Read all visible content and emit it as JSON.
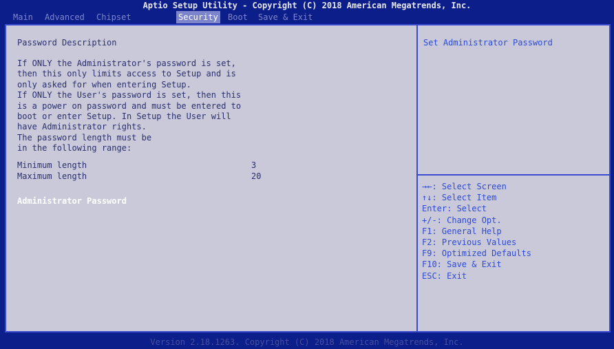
{
  "header": {
    "title": "Aptio Setup Utility - Copyright (C) 2018 American Megatrends, Inc."
  },
  "menu": {
    "tabs": [
      {
        "label": "Main",
        "active": false
      },
      {
        "label": "Advanced",
        "active": false
      },
      {
        "label": "Chipset",
        "active": false
      },
      {
        "label": "Security",
        "active": true
      },
      {
        "label": "Boot",
        "active": false
      },
      {
        "label": "Save & Exit",
        "active": false
      }
    ]
  },
  "security": {
    "description_title": "Password Description",
    "description_lines": [
      "If ONLY the Administrator's password is set,",
      "then this only limits access to Setup and is",
      "only asked for when entering Setup.",
      "If ONLY the User's password is set, then this",
      "is a power on password and must be entered to",
      "boot or enter Setup. In Setup the User will",
      "have Administrator rights.",
      "The password length must be",
      "in the following range:"
    ],
    "min_length_label": "Minimum length",
    "min_length_value": "3",
    "max_length_label": "Maximum length",
    "max_length_value": "20",
    "admin_password_label": "Administrator Password"
  },
  "help": {
    "text": "Set Administrator Password",
    "keys": [
      "→←: Select Screen",
      "↑↓: Select Item",
      "Enter: Select",
      "+/-: Change Opt.",
      "F1: General Help",
      "F2: Previous Values",
      "F9: Optimized Defaults",
      "F10: Save & Exit",
      "ESC: Exit"
    ]
  },
  "footer": {
    "text": "Version 2.18.1263. Copyright (C) 2018 American Megatrends, Inc."
  },
  "colors": {
    "background": "#0b1e8a",
    "panel": "#c9c9d9",
    "active_tab": "#7c84cc",
    "help_text": "#2d4ad6",
    "selected_item": "#ffffff"
  }
}
